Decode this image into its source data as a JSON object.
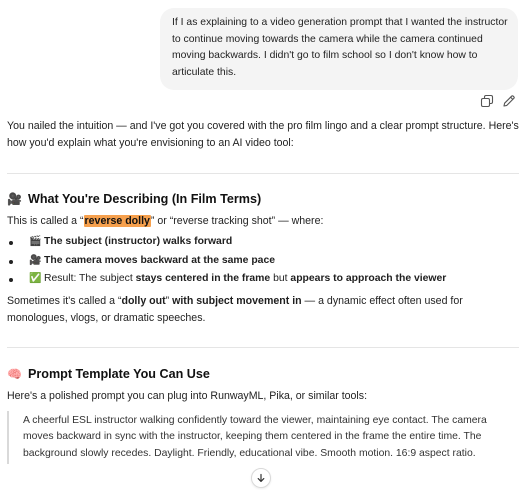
{
  "user_message": "If I as explaining to a video generation prompt that I wanted the instructor to continue moving towards the camera while the camera continued moving backwards. I didn't go to film school so I don't know how to articulate this.",
  "assistant": {
    "intro": "You nailed the intuition — and I've got you covered with the pro film lingo and a clear prompt structure. Here's how you'd explain what you're envisioning to an AI video tool:",
    "section1": {
      "emoji": "🎥",
      "title": "What You're Describing (In Film Terms)",
      "lead_pre": "This is called a “",
      "lead_term": "reverse dolly",
      "lead_mid": "” or “reverse tracking shot” — where:",
      "bullets": [
        {
          "icon": "🎬",
          "pre": "",
          "bold": "The subject (instructor) walks forward",
          "post": "",
          "bold2": ""
        },
        {
          "icon": "🎥",
          "pre": "",
          "bold": "The camera moves backward at the same pace",
          "post": "",
          "bold2": ""
        },
        {
          "icon": "✅",
          "pre": "Result: The subject ",
          "bold": "stays centered in the frame",
          "post": " but ",
          "bold2": "appears to approach the viewer"
        }
      ],
      "outro_pre": "Sometimes it's called a “",
      "outro_bold": "dolly out",
      "outro_mid": "” ",
      "outro_bold2": "with subject movement in",
      "outro_post": " — a dynamic effect often used for monologues, vlogs, or dramatic speeches."
    },
    "section2": {
      "emoji": "🧠",
      "title": "Prompt Template You Can Use",
      "lead": "Here's a polished prompt you can plug into RunwayML, Pika, or similar tools:",
      "quote": "A cheerful ESL instructor walking confidently toward the viewer, maintaining eye contact. The camera moves backward in sync with the instructor, keeping them centered in the frame the entire time. The background slowly recedes. Daylight. Friendly, educational vibe. Smooth motion. 16:9 aspect ratio."
    }
  },
  "icons": {
    "copy": "copy-icon",
    "edit": "edit-icon",
    "scroll": "arrow-down-icon"
  }
}
